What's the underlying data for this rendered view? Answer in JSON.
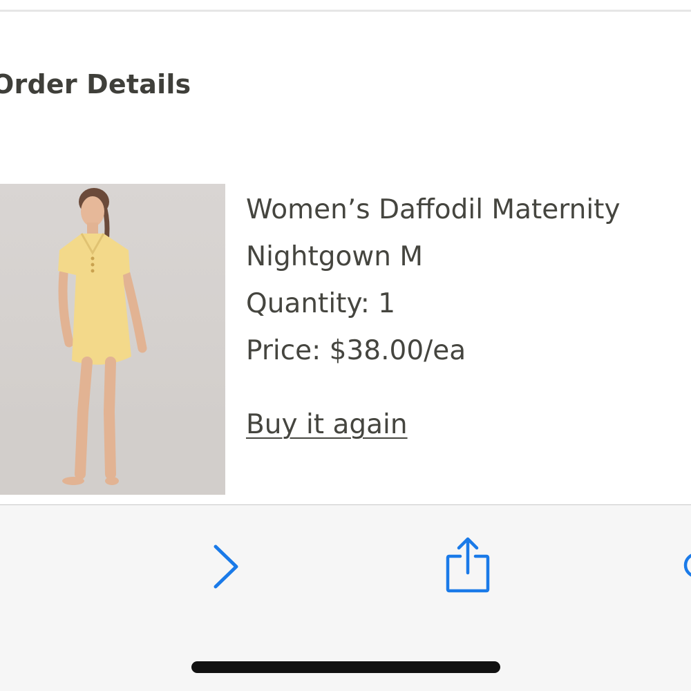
{
  "section": {
    "title": "Order Details"
  },
  "product": {
    "image_alt": "Women’s Daffodil Maternity Nightgown",
    "name_line1": "Women’s Daffodil Maternity",
    "name_line2": "Nightgown M",
    "quantity": "Quantity: 1",
    "price": "Price: $38.00/ea",
    "buy_again_label": "Buy it again"
  },
  "toolbar": {
    "forward_icon": "chevron-right-icon",
    "share_icon": "share-icon",
    "accent_color": "#1a7ae8"
  },
  "colors": {
    "text": "#45453f",
    "toolbar_bg": "#f6f6f6",
    "gown": "#f3d98a"
  }
}
